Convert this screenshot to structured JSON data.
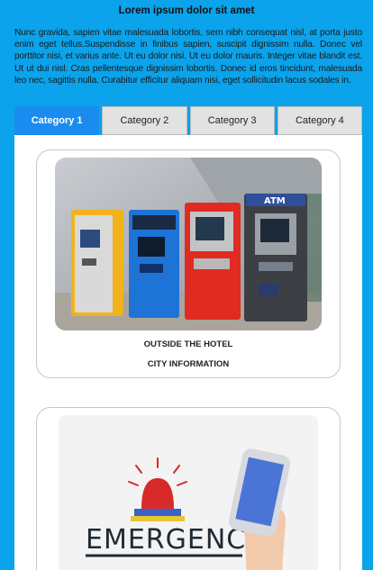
{
  "page": {
    "title": "Lorem ipsum dolor sit amet",
    "intro": "Nunc gravida, sapien vitae malesuada lobortis, sem nibh consequat nisl, at porta justo enim eget tellus.Suspendisse in finibus sapien, suscipit dignissim nulla. Donec vel porttitor nisi, et varius ante. Ut eu dolor nisi. Ut eu dolor mauris. Integer vitae blandit est. Ut ut dui nisl. Cras pellentesque dignissim lobortis. Donec id eros tincidunt, malesuada leo nec, sagittis nulla. Curabitur efficitur aliquam nisi, eget sollicitudin lacus sodales in."
  },
  "tabs": [
    {
      "label": "Category 1",
      "active": true
    },
    {
      "label": "Category 2",
      "active": false
    },
    {
      "label": "Category 3",
      "active": false
    },
    {
      "label": "Category 4",
      "active": false
    }
  ],
  "cards": [
    {
      "line1": "OUTSIDE THE HOTEL",
      "line2": "CITY INFORMATION",
      "image": "atm-machines-image"
    },
    {
      "image": "emergency-phone-image",
      "image_text": "EMERGENCY"
    }
  ],
  "colors": {
    "background": "#0aa3ec",
    "active_tab": "#1a8cf0",
    "inactive_tab": "#e2e2e2"
  }
}
